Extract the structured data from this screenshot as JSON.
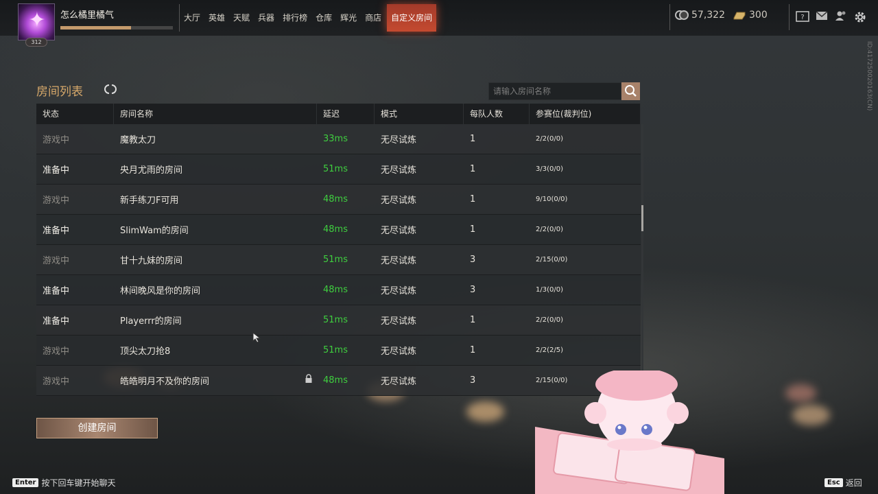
{
  "player": {
    "name": "怎么橘里橘气",
    "level": "312",
    "xp_fraction": 0.63
  },
  "nav": {
    "items": [
      "大厅",
      "英雄",
      "天赋",
      "兵器",
      "排行榜",
      "仓库",
      "辉光",
      "商店",
      "自定义房间"
    ],
    "active_index": 8
  },
  "currency": {
    "gold": "57,322",
    "tickets": "300"
  },
  "icons": [
    "help-book-icon",
    "mail-icon",
    "friends-icon",
    "settings-gear-icon"
  ],
  "id_text": "ID:417250020163(CN)",
  "room_list": {
    "title": "房间列表",
    "search_placeholder": "请输入房间名称",
    "columns": [
      "状态",
      "房间名称",
      "延迟",
      "模式",
      "每队人数",
      "参赛位(裁判位)"
    ],
    "rows": [
      {
        "status": "游戏中",
        "status_type": "playing",
        "name": "魔教太刀",
        "ping": "33ms",
        "mode": "无尽试炼",
        "team_size": "1",
        "slots": "2/2(0/0)",
        "locked": false
      },
      {
        "status": "准备中",
        "status_type": "ready",
        "name": "央月尤雨的房间",
        "ping": "51ms",
        "mode": "无尽试炼",
        "team_size": "1",
        "slots": "3/3(0/0)",
        "locked": false
      },
      {
        "status": "游戏中",
        "status_type": "playing",
        "name": "新手练刀F可用",
        "ping": "48ms",
        "mode": "无尽试炼",
        "team_size": "1",
        "slots": "9/10(0/0)",
        "locked": false
      },
      {
        "status": "准备中",
        "status_type": "ready",
        "name": "SlimWam的房间",
        "ping": "48ms",
        "mode": "无尽试炼",
        "team_size": "1",
        "slots": "2/2(0/0)",
        "locked": false
      },
      {
        "status": "游戏中",
        "status_type": "playing",
        "name": "甘十九妹的房间",
        "ping": "51ms",
        "mode": "无尽试炼",
        "team_size": "3",
        "slots": "2/15(0/0)",
        "locked": false
      },
      {
        "status": "准备中",
        "status_type": "ready",
        "name": "林间晚风是你的房间",
        "ping": "48ms",
        "mode": "无尽试炼",
        "team_size": "3",
        "slots": "1/3(0/0)",
        "locked": false
      },
      {
        "status": "准备中",
        "status_type": "ready",
        "name": "Playerrr的房间",
        "ping": "51ms",
        "mode": "无尽试炼",
        "team_size": "1",
        "slots": "2/2(0/0)",
        "locked": false
      },
      {
        "status": "游戏中",
        "status_type": "playing",
        "name": "顶尖太刀抢8",
        "ping": "51ms",
        "mode": "无尽试炼",
        "team_size": "1",
        "slots": "2/2(2/5)",
        "locked": false
      },
      {
        "status": "游戏中",
        "status_type": "playing",
        "name": "皓皓明月不及你的房间",
        "ping": "48ms",
        "mode": "无尽试炼",
        "team_size": "3",
        "slots": "2/15(0/0)",
        "locked": true
      }
    ],
    "scroll_fraction": 0.3
  },
  "create_button": "创建房间",
  "hints": {
    "chat_key": "Enter",
    "chat_text": "按下回车键开始聊天",
    "back_key": "Esc",
    "back_text": "返回"
  }
}
